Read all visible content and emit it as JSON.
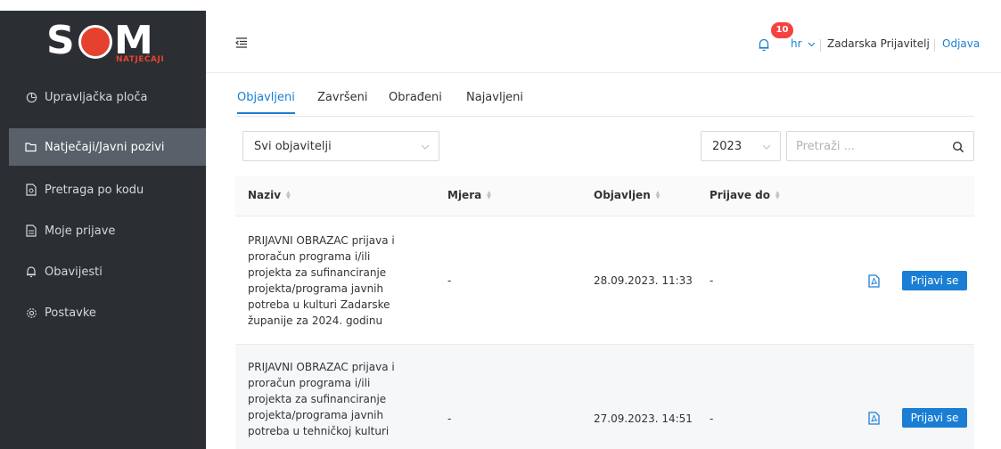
{
  "logo": {
    "text_left": "S",
    "text_right": "M",
    "subtitle": "NATJEČAJI"
  },
  "sidebar": {
    "items": [
      {
        "label": "Upravljačka ploča",
        "icon": "dashboard-icon"
      },
      {
        "label": "Natječaji/Javni pozivi",
        "icon": "folder-icon",
        "active": true
      },
      {
        "label": "Pretraga po kodu",
        "icon": "file-search-icon"
      },
      {
        "label": "Moje prijave",
        "icon": "document-icon"
      },
      {
        "label": "Obavijesti",
        "icon": "bell-icon"
      },
      {
        "label": "Postavke",
        "icon": "gear-icon"
      }
    ]
  },
  "header": {
    "notification_count": "10",
    "language": "hr",
    "username": "Zadarska Prijavitelj",
    "logout": "Odjava"
  },
  "tabs": [
    "Objavljeni",
    "Završeni",
    "Obrađeni",
    "Najavljeni"
  ],
  "filters": {
    "publisher": "Svi objavitelji",
    "year": "2023",
    "search_placeholder": "Pretraži ..."
  },
  "table": {
    "columns": [
      "Naziv",
      "Mjera",
      "Objavljen",
      "Prijave do"
    ],
    "rows": [
      {
        "name_lines": [
          "PRIJAVNI OBRAZAC prijava i",
          "proračun programa i/ili",
          "projekta za sufinanciranje",
          "projekta/programa javnih",
          "potreba u kulturi Zadarske",
          "županije za 2024. godinu"
        ],
        "mjera": "-",
        "published": "28.09.2023. 11:33",
        "due": "-",
        "action": "Prijavi se"
      },
      {
        "name_lines": [
          "PRIJAVNI OBRAZAC prijava i",
          "proračun programa i/ili",
          "projekta za sufinanciranje",
          "projekta/programa javnih",
          "potreba u tehničkoj kulturi"
        ],
        "mjera": "-",
        "published": "27.09.2023. 14:51",
        "due": "-",
        "action": "Prijavi se"
      }
    ]
  },
  "colors": {
    "sidebar": "#2b2f33",
    "sidebar_active": "#596069",
    "accent": "#1a7fd4",
    "badge": "#f5423f",
    "brand_red": "#e4422e"
  }
}
